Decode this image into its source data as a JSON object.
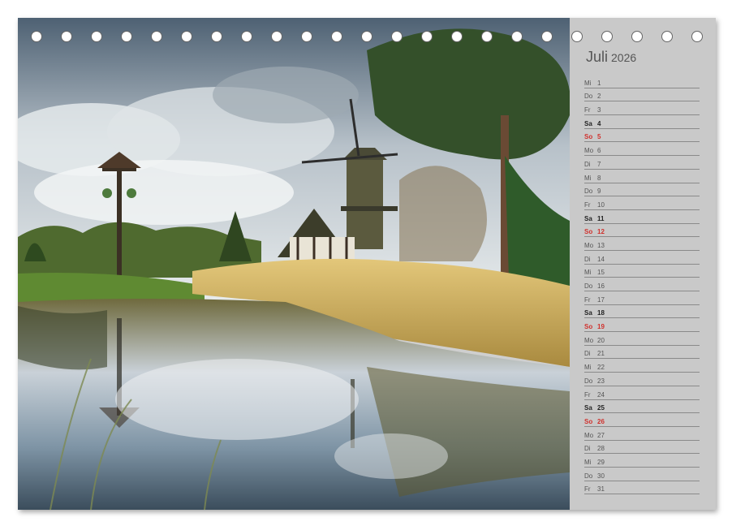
{
  "calendar": {
    "month": "Juli",
    "year": "2026",
    "days": [
      {
        "wd": "Mi",
        "d": "1",
        "type": "weekday"
      },
      {
        "wd": "Do",
        "d": "2",
        "type": "weekday"
      },
      {
        "wd": "Fr",
        "d": "3",
        "type": "weekday"
      },
      {
        "wd": "Sa",
        "d": "4",
        "type": "sat"
      },
      {
        "wd": "So",
        "d": "5",
        "type": "sun"
      },
      {
        "wd": "Mo",
        "d": "6",
        "type": "weekday"
      },
      {
        "wd": "Di",
        "d": "7",
        "type": "weekday"
      },
      {
        "wd": "Mi",
        "d": "8",
        "type": "weekday"
      },
      {
        "wd": "Do",
        "d": "9",
        "type": "weekday"
      },
      {
        "wd": "Fr",
        "d": "10",
        "type": "weekday"
      },
      {
        "wd": "Sa",
        "d": "11",
        "type": "sat"
      },
      {
        "wd": "So",
        "d": "12",
        "type": "sun"
      },
      {
        "wd": "Mo",
        "d": "13",
        "type": "weekday"
      },
      {
        "wd": "Di",
        "d": "14",
        "type": "weekday"
      },
      {
        "wd": "Mi",
        "d": "15",
        "type": "weekday"
      },
      {
        "wd": "Do",
        "d": "16",
        "type": "weekday"
      },
      {
        "wd": "Fr",
        "d": "17",
        "type": "weekday"
      },
      {
        "wd": "Sa",
        "d": "18",
        "type": "sat"
      },
      {
        "wd": "So",
        "d": "19",
        "type": "sun"
      },
      {
        "wd": "Mo",
        "d": "20",
        "type": "weekday"
      },
      {
        "wd": "Di",
        "d": "21",
        "type": "weekday"
      },
      {
        "wd": "Mi",
        "d": "22",
        "type": "weekday"
      },
      {
        "wd": "Do",
        "d": "23",
        "type": "weekday"
      },
      {
        "wd": "Fr",
        "d": "24",
        "type": "weekday"
      },
      {
        "wd": "Sa",
        "d": "25",
        "type": "sat"
      },
      {
        "wd": "So",
        "d": "26",
        "type": "sun"
      },
      {
        "wd": "Mo",
        "d": "27",
        "type": "weekday"
      },
      {
        "wd": "Di",
        "d": "28",
        "type": "weekday"
      },
      {
        "wd": "Mi",
        "d": "29",
        "type": "weekday"
      },
      {
        "wd": "Do",
        "d": "30",
        "type": "weekday"
      },
      {
        "wd": "Fr",
        "d": "31",
        "type": "weekday"
      }
    ]
  },
  "colors": {
    "sunday": "#d0312d",
    "panel": "#c9c9c9"
  }
}
